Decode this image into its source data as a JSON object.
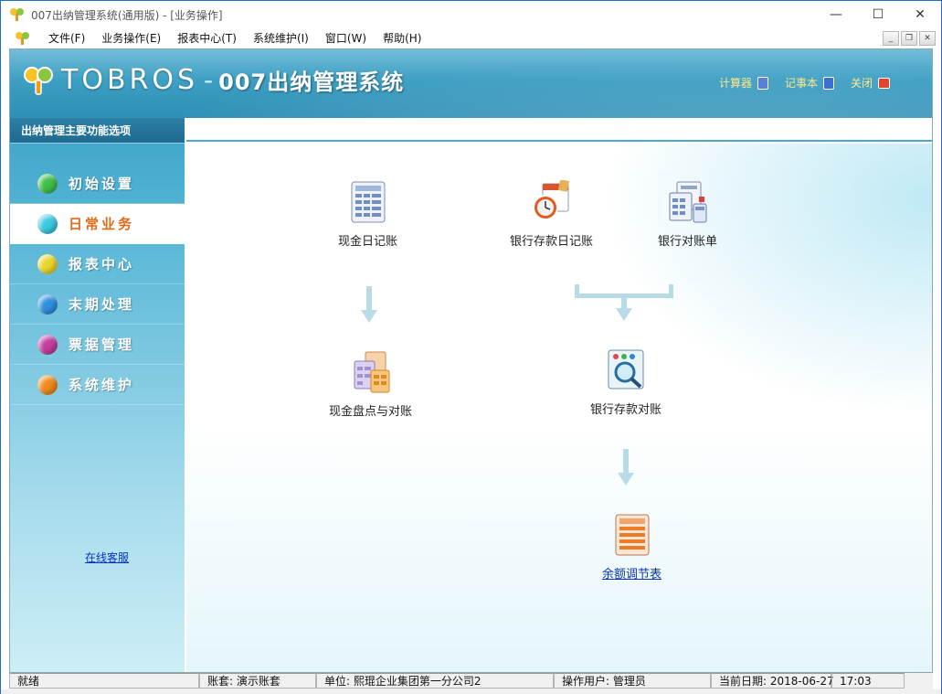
{
  "window": {
    "title": "007出纳管理系统(通用版) - [业务操作]",
    "minimize": "—",
    "maximize": "☐",
    "close": "✕"
  },
  "menu": {
    "items": [
      "文件(F)",
      "业务操作(E)",
      "报表中心(T)",
      "系统维护(I)",
      "窗口(W)",
      "帮助(H)"
    ]
  },
  "header": {
    "brand": "TOBROS",
    "dash": "-",
    "product": "007出纳管理系统",
    "links": [
      {
        "label": "计算器",
        "icon": "calculator-icon",
        "color": "#5a7fd6"
      },
      {
        "label": "记事本",
        "icon": "notepad-icon",
        "color": "#3d6fd0"
      },
      {
        "label": "关闭",
        "icon": "power-icon",
        "color": "#e2452a"
      }
    ]
  },
  "sidebar": {
    "title": "出纳管理主要功能选项",
    "items": [
      {
        "label": "初始设置",
        "color": "#3fbf4a"
      },
      {
        "label": "日常业务",
        "color": "#38c9e0"
      },
      {
        "label": "报表中心",
        "color": "#e8d62c"
      },
      {
        "label": "末期处理",
        "color": "#2f8fe0"
      },
      {
        "label": "票据管理",
        "color": "#c43ea0"
      },
      {
        "label": "系统维护",
        "color": "#f08a1e"
      }
    ],
    "active_index": 1,
    "online_service": "在线客服"
  },
  "workflow": {
    "cash_journal": "现金日记账",
    "bank_journal": "银行存款日记账",
    "bank_statement": "银行对账单",
    "cash_count": "现金盘点与对账",
    "bank_reconcile": "银行存款对账",
    "balance_adjust": "余额调节表"
  },
  "status": {
    "ready": "就绪",
    "account_set": "账套:  演示账套",
    "unit": "单位:  熙琨企业集团第一分公司2",
    "user": "操作用户:  管理员",
    "date": "当前日期: 2018-06-27",
    "time": "17:03"
  }
}
